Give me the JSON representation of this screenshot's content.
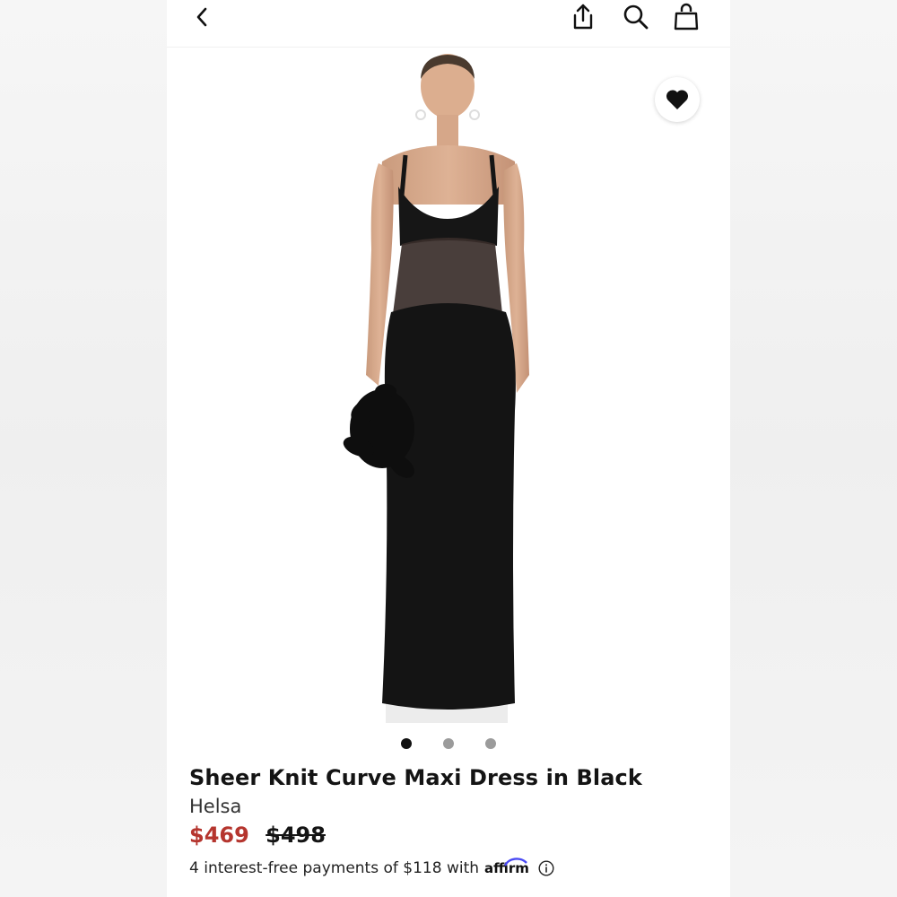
{
  "header": {
    "back_icon": "chevron-left-icon",
    "share_icon": "share-icon",
    "search_icon": "search-icon",
    "bag_icon": "shopping-bag-icon"
  },
  "gallery": {
    "favorite_icon": "heart-icon",
    "image_count": 3,
    "active_index": 0
  },
  "product": {
    "name": "Sheer Knit Curve Maxi Dress in Black",
    "brand": "Helsa",
    "sale_price": "$469",
    "original_price": "$498",
    "installments_text": "4 interest-free payments of $118 with",
    "installments_provider": "affirm",
    "info_icon": "info-icon"
  },
  "colors": {
    "sale_price": "#b5352e",
    "text": "#141414",
    "dot_active": "#111111",
    "dot_inactive": "#9b9b9b"
  }
}
